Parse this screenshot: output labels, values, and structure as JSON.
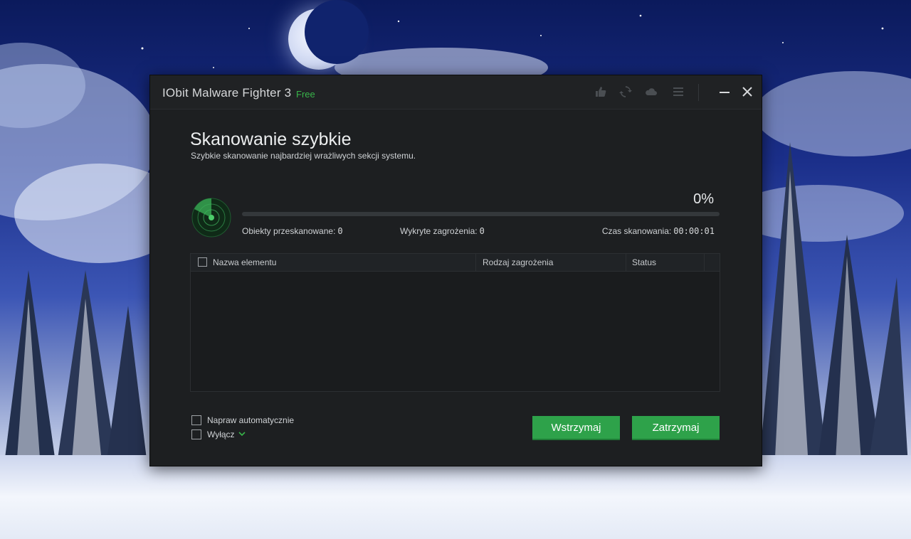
{
  "window": {
    "app_name": "IObit Malware Fighter 3",
    "edition_badge": "Free",
    "toolbar_icons": [
      "thumbs-up-icon",
      "update-icon",
      "cloud-icon",
      "menu-icon"
    ],
    "controls": [
      "minimize-icon",
      "close-icon"
    ]
  },
  "scan": {
    "title": "Skanowanie szybkie",
    "subtitle": "Szybkie skanowanie najbardziej wrażliwych sekcji systemu.",
    "progress_label": "0%",
    "progress_fraction": 0.0,
    "objects_label": "Obiekty przeskanowane:",
    "objects_value": "0",
    "threats_label": "Wykryte zagrożenia:",
    "threats_value": "0",
    "time_label": "Czas skanowania:",
    "time_value": "00:00:01"
  },
  "results_table": {
    "columns": [
      "Nazwa elementu",
      "Rodzaj zagrożenia",
      "Status"
    ],
    "rows": []
  },
  "options": {
    "auto_fix_label": "Napraw automatycznie",
    "shutdown_label": "Wyłącz"
  },
  "buttons": {
    "pause_label": "Wstrzymaj",
    "stop_label": "Zatrzymaj"
  },
  "colors": {
    "accent_green": "#2ea24a",
    "window_bg": "#1d1f21"
  }
}
